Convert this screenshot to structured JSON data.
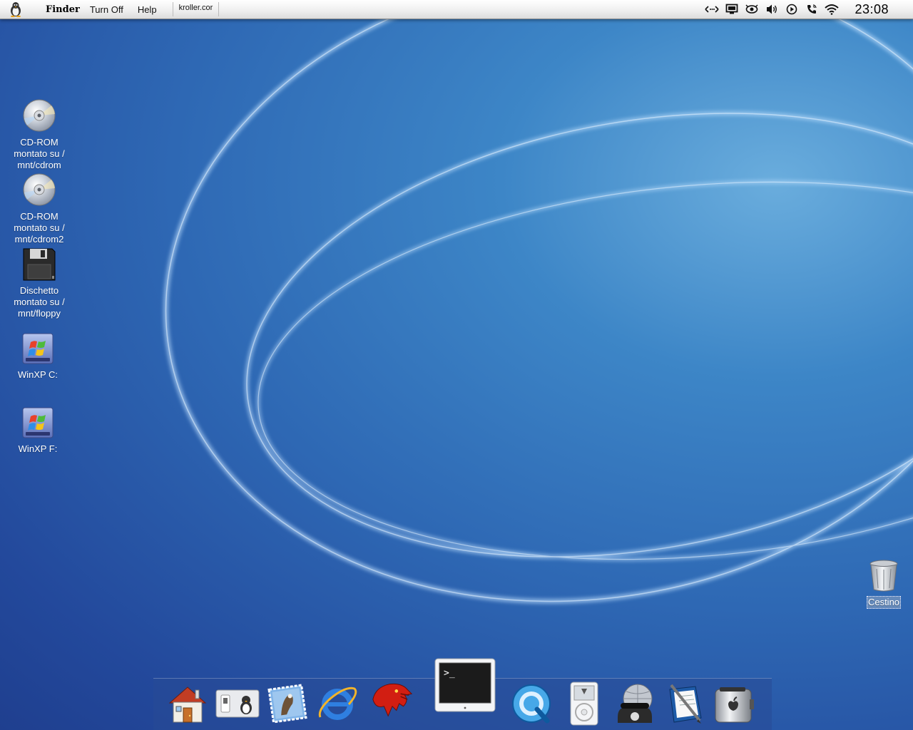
{
  "menubar": {
    "app_name": "Finder",
    "items": [
      "Turn Off",
      "Help"
    ],
    "hostname": "kroller.cor",
    "clock": "23:08",
    "tray_icons": [
      "network-icon",
      "display-icon",
      "monitor-icon",
      "volume-icon",
      "play-icon",
      "phone-icon",
      "wifi-icon"
    ]
  },
  "desktop_icons": [
    {
      "name": "cdrom-icon",
      "label": "CD-ROM montato su / mnt/cdrom"
    },
    {
      "name": "cdrom2-icon",
      "label": "CD-ROM montato su / mnt/cdrom2"
    },
    {
      "name": "floppy-icon",
      "label": "Dischetto montato su / mnt/floppy"
    },
    {
      "name": "winxp-c-drive-icon",
      "label": "WinXP C:"
    },
    {
      "name": "winxp-f-drive-icon",
      "label": "WinXP F:"
    }
  ],
  "trash": {
    "label": "Cestino"
  },
  "dock": {
    "items": [
      "home-icon",
      "control-panel-icon",
      "mail-icon",
      "internet-explorer-icon",
      "mozilla-icon",
      "terminal-icon",
      "quicktime-icon",
      "ipod-icon",
      "network-phone-icon",
      "text-editor-icon",
      "toaster-icon"
    ],
    "terminal_prompt": ">_"
  },
  "colors": {
    "wallpaper_dark": "#23499c",
    "wallpaper_light": "#6aaddd",
    "dock_background": "#284b96"
  }
}
